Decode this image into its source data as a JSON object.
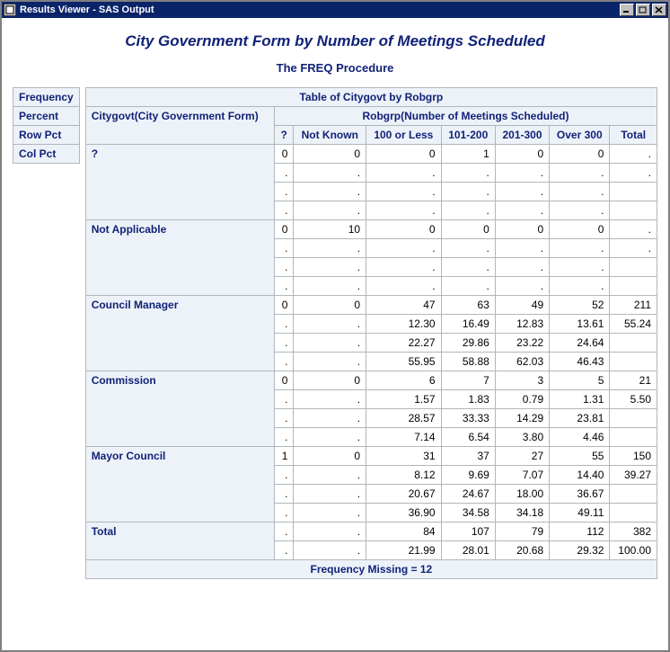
{
  "window": {
    "title": "Results Viewer - SAS Output"
  },
  "page": {
    "title": "City Government Form by Number of Meetings Scheduled",
    "procedure": "The FREQ Procedure"
  },
  "legend": {
    "items": [
      "Frequency",
      "Percent",
      "Row Pct",
      "Col Pct"
    ]
  },
  "table": {
    "caption": "Table of Citygovt by Robgrp",
    "row_var_label": "Citygovt(City Government Form)",
    "col_var_label": "Robgrp(Number of Meetings Scheduled)",
    "col_headers": [
      "?",
      "Not Known",
      "100 or Less",
      "101-200",
      "201-300",
      "Over 300",
      "Total"
    ],
    "rows": [
      {
        "label": "?",
        "freq": [
          "0",
          "0",
          "0",
          "1",
          "0",
          "0",
          "."
        ],
        "percent": [
          ".",
          ".",
          ".",
          ".",
          ".",
          ".",
          "."
        ],
        "rowpct": [
          ".",
          ".",
          ".",
          ".",
          ".",
          ".",
          ""
        ],
        "colpct": [
          ".",
          ".",
          ".",
          ".",
          ".",
          ".",
          ""
        ]
      },
      {
        "label": "Not Applicable",
        "freq": [
          "0",
          "10",
          "0",
          "0",
          "0",
          "0",
          "."
        ],
        "percent": [
          ".",
          ".",
          ".",
          ".",
          ".",
          ".",
          "."
        ],
        "rowpct": [
          ".",
          ".",
          ".",
          ".",
          ".",
          ".",
          ""
        ],
        "colpct": [
          ".",
          ".",
          ".",
          ".",
          ".",
          ".",
          ""
        ]
      },
      {
        "label": "Council Manager",
        "freq": [
          "0",
          "0",
          "47",
          "63",
          "49",
          "52",
          "211"
        ],
        "percent": [
          ".",
          ".",
          "12.30",
          "16.49",
          "12.83",
          "13.61",
          "55.24"
        ],
        "rowpct": [
          ".",
          ".",
          "22.27",
          "29.86",
          "23.22",
          "24.64",
          ""
        ],
        "colpct": [
          ".",
          ".",
          "55.95",
          "58.88",
          "62.03",
          "46.43",
          ""
        ]
      },
      {
        "label": "Commission",
        "freq": [
          "0",
          "0",
          "6",
          "7",
          "3",
          "5",
          "21"
        ],
        "percent": [
          ".",
          ".",
          "1.57",
          "1.83",
          "0.79",
          "1.31",
          "5.50"
        ],
        "rowpct": [
          ".",
          ".",
          "28.57",
          "33.33",
          "14.29",
          "23.81",
          ""
        ],
        "colpct": [
          ".",
          ".",
          "7.14",
          "6.54",
          "3.80",
          "4.46",
          ""
        ]
      },
      {
        "label": "Mayor Council",
        "freq": [
          "1",
          "0",
          "31",
          "37",
          "27",
          "55",
          "150"
        ],
        "percent": [
          ".",
          ".",
          "8.12",
          "9.69",
          "7.07",
          "14.40",
          "39.27"
        ],
        "rowpct": [
          ".",
          ".",
          "20.67",
          "24.67",
          "18.00",
          "36.67",
          ""
        ],
        "colpct": [
          ".",
          ".",
          "36.90",
          "34.58",
          "34.18",
          "49.11",
          ""
        ]
      }
    ],
    "total_row": {
      "label": "Total",
      "freq": [
        ".",
        ".",
        "84",
        "107",
        "79",
        "112",
        "382"
      ],
      "percent": [
        ".",
        ".",
        "21.99",
        "28.01",
        "20.68",
        "29.32",
        "100.00"
      ]
    },
    "footnote": "Frequency Missing = 12"
  },
  "chart_data": {
    "type": "table",
    "title": "Table of Citygovt by Robgrp",
    "row_variable": "Citygovt (City Government Form)",
    "col_variable": "Robgrp (Number of Meetings Scheduled)",
    "columns": [
      "?",
      "Not Known",
      "100 or Less",
      "101-200",
      "201-300",
      "Over 300"
    ],
    "rows": [
      "?",
      "Not Applicable",
      "Council Manager",
      "Commission",
      "Mayor Council"
    ],
    "frequency": [
      [
        0,
        0,
        0,
        1,
        0,
        0
      ],
      [
        0,
        10,
        0,
        0,
        0,
        0
      ],
      [
        0,
        0,
        47,
        63,
        49,
        52
      ],
      [
        0,
        0,
        6,
        7,
        3,
        5
      ],
      [
        1,
        0,
        31,
        37,
        27,
        55
      ]
    ],
    "row_totals": [
      null,
      null,
      211,
      21,
      150
    ],
    "col_totals": [
      null,
      null,
      84,
      107,
      79,
      112
    ],
    "grand_total": 382,
    "percent_of_total": [
      [
        null,
        null,
        null,
        null,
        null,
        null
      ],
      [
        null,
        null,
        null,
        null,
        null,
        null
      ],
      [
        null,
        null,
        12.3,
        16.49,
        12.83,
        13.61
      ],
      [
        null,
        null,
        1.57,
        1.83,
        0.79,
        1.31
      ],
      [
        null,
        null,
        8.12,
        9.69,
        7.07,
        14.4
      ]
    ],
    "row_percent": [
      [
        null,
        null,
        null,
        null,
        null,
        null
      ],
      [
        null,
        null,
        null,
        null,
        null,
        null
      ],
      [
        null,
        null,
        22.27,
        29.86,
        23.22,
        24.64
      ],
      [
        null,
        null,
        28.57,
        33.33,
        14.29,
        23.81
      ],
      [
        null,
        null,
        20.67,
        24.67,
        18.0,
        36.67
      ]
    ],
    "col_percent": [
      [
        null,
        null,
        null,
        null,
        null,
        null
      ],
      [
        null,
        null,
        null,
        null,
        null,
        null
      ],
      [
        null,
        null,
        55.95,
        58.88,
        62.03,
        46.43
      ],
      [
        null,
        null,
        7.14,
        6.54,
        3.8,
        4.46
      ],
      [
        null,
        null,
        36.9,
        34.58,
        34.18,
        49.11
      ]
    ],
    "col_total_percent": [
      null,
      null,
      21.99,
      28.01,
      20.68,
      29.32
    ],
    "row_total_percent": [
      null,
      null,
      55.24,
      5.5,
      39.27
    ],
    "frequency_missing": 12
  }
}
